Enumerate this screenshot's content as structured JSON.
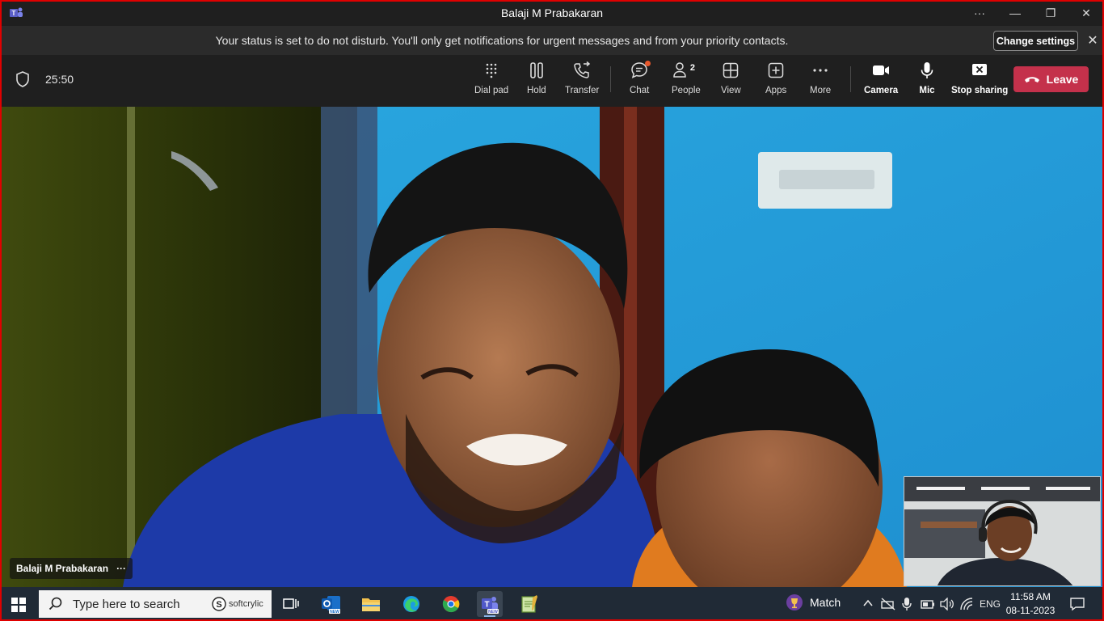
{
  "window": {
    "title": "Balaji M Prabakaran",
    "more_label": "···",
    "minimize_label": "—",
    "restore_label": "❐",
    "close_label": "✕"
  },
  "banner": {
    "message": "Your status is set to do not disturb. You'll only get notifications for urgent messages and from your priority contacts.",
    "change_settings_label": "Change settings",
    "close_label": "✕"
  },
  "toolbar": {
    "timer": "25:50",
    "buttons": {
      "dialpad": "Dial pad",
      "hold": "Hold",
      "transfer": "Transfer",
      "chat": "Chat",
      "people": "People",
      "people_count": "2",
      "view": "View",
      "apps": "Apps",
      "more": "More",
      "camera": "Camera",
      "mic": "Mic",
      "stop_sharing": "Stop sharing"
    },
    "leave_label": "Leave",
    "leave_color": "#c4314b"
  },
  "video": {
    "participant_name": "Balaji M Prabakaran",
    "more_label": "···"
  },
  "taskbar": {
    "search_placeholder": "Type here to search",
    "search_brand": "softcrylic",
    "weather_widget": "Match",
    "language": "ENG",
    "time": "11:58 AM",
    "date": "08-11-2023",
    "apps": [
      "task-view-icon",
      "outlook-icon",
      "file-explorer-icon",
      "edge-icon",
      "chrome-icon",
      "teams-icon",
      "notepad-icon"
    ]
  }
}
